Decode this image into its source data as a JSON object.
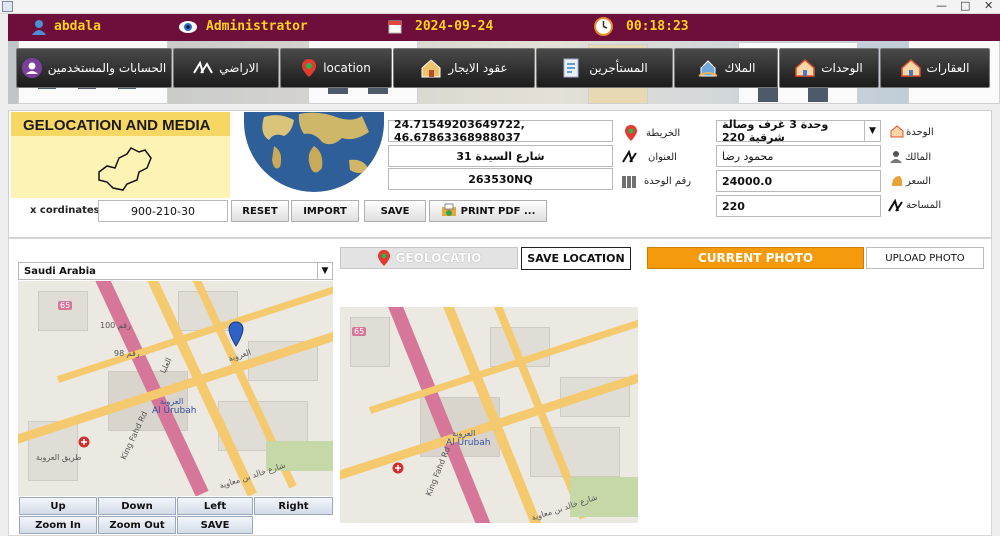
{
  "window": {
    "controls": [
      "—",
      "□",
      "✕"
    ]
  },
  "header": {
    "user": "abdala",
    "role": "Administrator",
    "date": "2024-09-24",
    "time": "00:18:23"
  },
  "nav": {
    "accounts": "الحسابات والمستخدمين",
    "lands": "الاراضي",
    "location": "location",
    "leases": "عقود الايجار",
    "tenants": "المستأجرين",
    "owners": "الملاك",
    "units": "الوحدات",
    "properties": "العقارات"
  },
  "geo": {
    "title": "GELOCATION AND MEDIA",
    "x_label": "x cordinates",
    "x_value": "900-210-30",
    "coords": "24.71549203649722, 46.67863368988037",
    "address": "شارع السيدة 31",
    "unit_no": "263530NQ"
  },
  "buttons": {
    "reset": "RESET",
    "import": "IMPORT",
    "save": "SAVE",
    "print": "PRINT PDF ..."
  },
  "labels": {
    "map": "الخريطة",
    "address": "العنوان",
    "unit_no": "رقم الوحدة",
    "unit": "الوحدة",
    "owner": "المالك",
    "price": "السعر",
    "area": "المساحة"
  },
  "unit": {
    "selected": "وحدة 3 غرف وصالة شرقية 220",
    "owner": "محمود رضا",
    "price": "24000.0",
    "area": "220"
  },
  "map": {
    "country": "Saudi Arabia",
    "district_ar": "العروبة",
    "district_en": "Al Urubah",
    "street1": "King Fahd Rd",
    "street2": "طريق العروبة",
    "street3": "العروبة",
    "street4": "العليا",
    "street5": "رقم 98",
    "street6": "رقم 100",
    "street7": "شارع خالد بن معاوية",
    "route": "65"
  },
  "map_controls": {
    "up": "Up",
    "down": "Down",
    "left": "Left",
    "right": "Right",
    "zoom_in": "Zoom In",
    "zoom_out": "Zoom Out",
    "save": "SAVE"
  },
  "media": {
    "geolocation": "GEOLOCATIO",
    "save_location": "SAVE LOCATION",
    "current_photo": "CURRENT PHOTO",
    "upload_photo": "UPLOAD PHOTO"
  }
}
